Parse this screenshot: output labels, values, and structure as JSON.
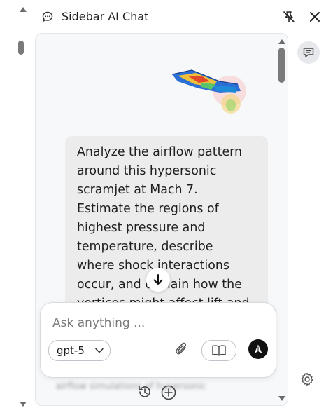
{
  "header": {
    "title": "Sidebar AI Chat",
    "title_icon": "chat-bubble-icon",
    "pin_icon": "pin-off-icon",
    "close_icon": "close-icon"
  },
  "conversation": {
    "attachment": {
      "kind": "image",
      "icon": "cfd-scramjet-render"
    },
    "user_message": "Analyze the airflow pattern around this hypersonic scramjet at Mach 7. Estimate the regions of highest pressure and temperature, describe where shock interactions occur, and explain how the vortices might affect lift and stability",
    "blurred_preview": "airflow simulations of hypersonic"
  },
  "composer": {
    "placeholder": "Ask anything ...",
    "model": "gpt-5",
    "attach_icon": "paperclip-icon",
    "library_icon": "book-icon",
    "send_icon": "send-icon"
  },
  "footer": {
    "history_icon": "history-icon",
    "new_chat_icon": "plus-circle-icon"
  },
  "rail": {
    "chat_icon": "chat-icon",
    "settings_icon": "gear-icon"
  },
  "colors": {
    "user_bubble": "#ececec",
    "pane_bg": "#f7f8fa",
    "send_button": "#111111",
    "rail_active": "#e6e8eb"
  }
}
